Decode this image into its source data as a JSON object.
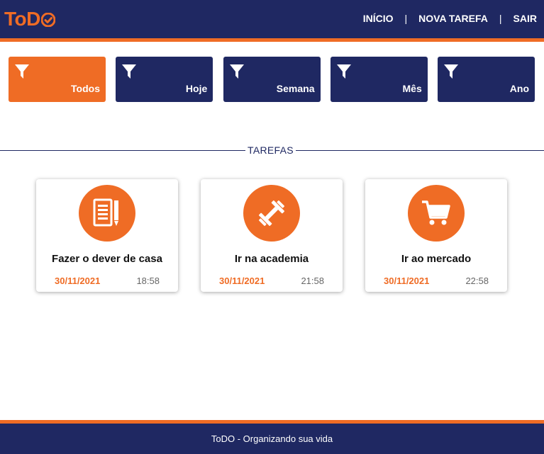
{
  "header": {
    "logo": "ToD",
    "nav": {
      "home": "INÍCIO",
      "new_task": "NOVA TAREFA",
      "logout": "SAIR",
      "separator": "|"
    }
  },
  "filters": [
    {
      "label": "Todos",
      "icon": "funnel-icon",
      "active": true
    },
    {
      "label": "Hoje",
      "icon": "funnel-icon",
      "active": false
    },
    {
      "label": "Semana",
      "icon": "funnel-icon",
      "active": false
    },
    {
      "label": "Mês",
      "icon": "funnel-icon",
      "active": false
    },
    {
      "label": "Ano",
      "icon": "funnel-icon",
      "active": false
    }
  ],
  "section": {
    "title": "TAREFAS"
  },
  "tasks": [
    {
      "title": "Fazer o dever de casa",
      "date": "30/11/2021",
      "time": "18:58",
      "icon": "document-pencil-icon"
    },
    {
      "title": "Ir na academia",
      "date": "30/11/2021",
      "time": "21:58",
      "icon": "dumbbell-icon"
    },
    {
      "title": "Ir ao mercado",
      "date": "30/11/2021",
      "time": "22:58",
      "icon": "shopping-cart-icon"
    }
  ],
  "footer": {
    "text": "ToDO - Organizando sua vida"
  },
  "colors": {
    "navy": "#1f2862",
    "orange": "#ef6c25",
    "white": "#ffffff"
  }
}
